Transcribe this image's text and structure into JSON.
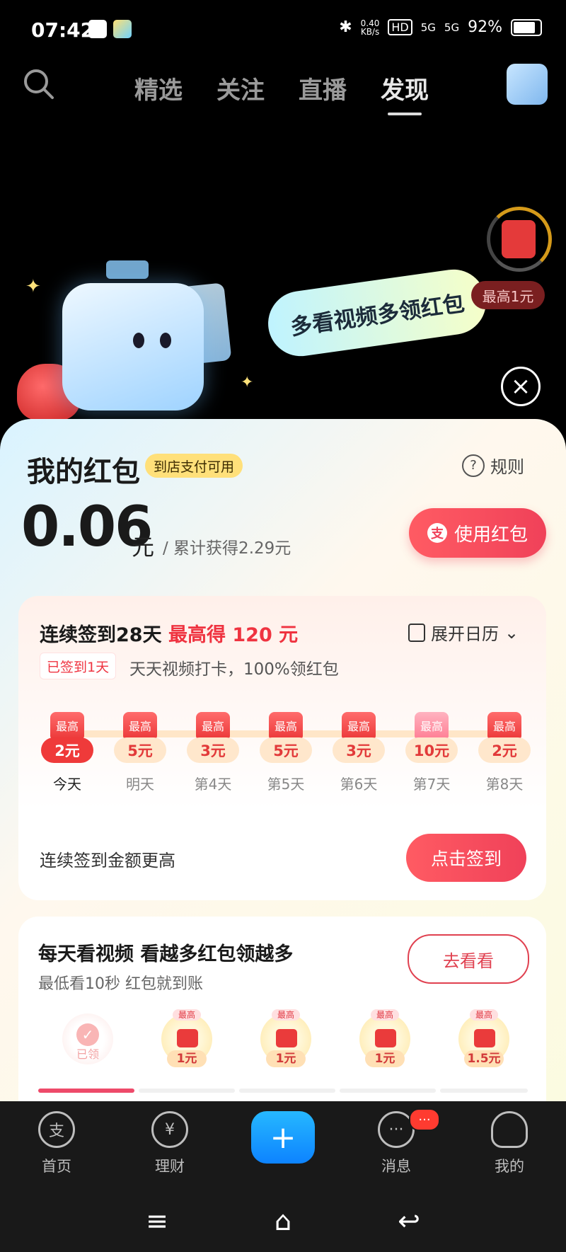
{
  "status_bar": {
    "time": "07:42",
    "net_speed": "0.40",
    "net_unit": "KB/s",
    "hd": "HD",
    "sig1": "5G",
    "sig2": "5G",
    "battery": "92%"
  },
  "top_nav": {
    "tabs": [
      {
        "label": "精选"
      },
      {
        "label": "关注"
      },
      {
        "label": "直播"
      },
      {
        "label": "发现"
      }
    ],
    "active_tab": "发现"
  },
  "hero": {
    "bubble_text": "多看视频多领红包",
    "timer_label": "最高1元"
  },
  "wallet": {
    "title": "我的红包",
    "tag": "到店支付可用",
    "rules_label": "规则",
    "amount": "0.06",
    "unit": "元",
    "total_text": "/ 累计获得2.29元",
    "use_button": "使用红包"
  },
  "checkin": {
    "title_main": "连续签到28天",
    "title_highlight": "最高得 120 元",
    "calendar_label": "展开日历",
    "signed_badge": "已签到1天",
    "subtitle": "天天视频打卡，100%领红包",
    "days": [
      {
        "top": "最高",
        "amount": "2元",
        "label": "今天"
      },
      {
        "top": "最高",
        "amount": "5元",
        "label": "明天"
      },
      {
        "top": "最高",
        "amount": "3元",
        "label": "第4天"
      },
      {
        "top": "最高",
        "amount": "5元",
        "label": "第5天"
      },
      {
        "top": "最高",
        "amount": "3元",
        "label": "第6天"
      },
      {
        "top": "最高",
        "amount": "10元",
        "label": "第7天"
      },
      {
        "top": "最高",
        "amount": "2元",
        "label": "第8天"
      }
    ],
    "note": "连续签到金额更高",
    "sign_button": "点击签到"
  },
  "video": {
    "title": "每天看视频 看越多红包领越多",
    "subtitle": "最低看10秒 红包就到账",
    "go_button": "去看看",
    "items": [
      {
        "top": "",
        "amount": "",
        "status": "已领"
      },
      {
        "top": "最高",
        "amount": "1元",
        "status": ""
      },
      {
        "top": "最高",
        "amount": "1元",
        "status": ""
      },
      {
        "top": "最高",
        "amount": "1元",
        "status": ""
      },
      {
        "top": "最高",
        "amount": "1.5元",
        "status": ""
      }
    ],
    "progress_done_segments": 1,
    "progress_total_segments": 5
  },
  "bottom_nav": {
    "items": [
      {
        "label": "首页"
      },
      {
        "label": "理财"
      },
      {
        "label": "消息"
      },
      {
        "label": "我的"
      }
    ],
    "badge": "···"
  },
  "colors": {
    "accent": "#f04159",
    "highlight": "#ef3340",
    "plus": "#0d83ff"
  }
}
